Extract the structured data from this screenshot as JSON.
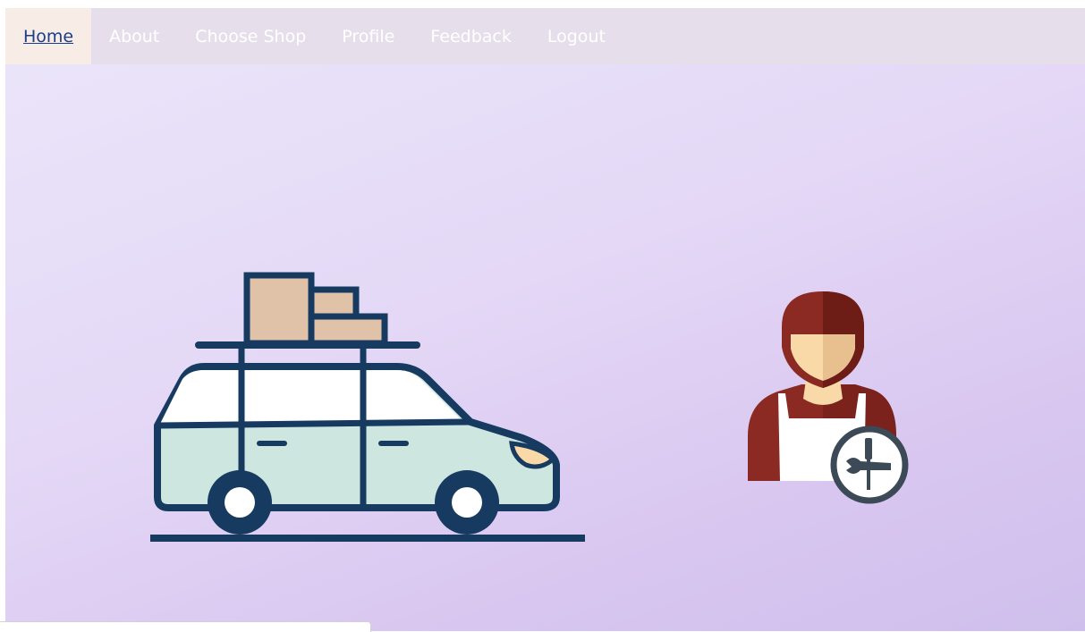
{
  "nav": {
    "items": [
      {
        "label": "Home",
        "active": true
      },
      {
        "label": "About",
        "active": false
      },
      {
        "label": "Choose Shop",
        "active": false
      },
      {
        "label": "Profile",
        "active": false
      },
      {
        "label": "Feedback",
        "active": false
      },
      {
        "label": "Logout",
        "active": false
      }
    ]
  },
  "colors": {
    "navbar_bg": "#e6dfeb",
    "active_tab_bg": "#f7ece6",
    "active_link": "#1a3f8a",
    "nav_text": "#ffffff",
    "car_outline": "#163a60",
    "car_body": "#cde6df",
    "cargo_box": "#e0c2a8",
    "mechanic_red": "#8b2a22",
    "mechanic_skin": "#fad9a8"
  },
  "icons": {
    "car": "car-with-roof-cargo-icon",
    "mechanic": "mechanic-with-tools-icon"
  }
}
